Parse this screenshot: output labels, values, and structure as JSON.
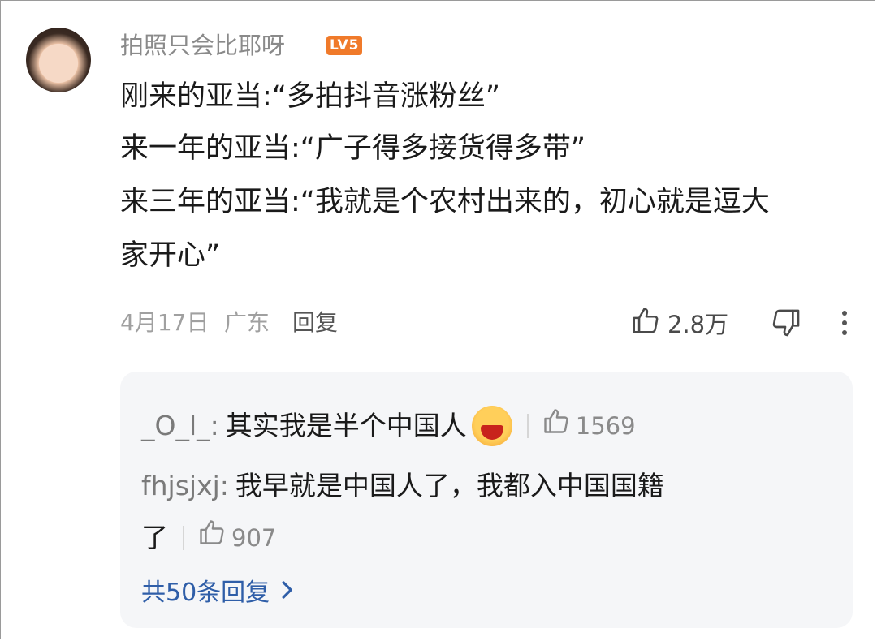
{
  "comment": {
    "username": "拍照只会比耶呀",
    "level_badge": "LV5",
    "lines": [
      "刚来的亚当:“多拍抖音涨粉丝”",
      "来一年的亚当:“广子得多接货得多带”",
      "来三年的亚当:“我就是个农村出来的，初心就是逗大",
      "家开心”"
    ],
    "date": "4月17日",
    "location": "广东",
    "reply_label": "回复",
    "like_count": "2.8万"
  },
  "replies": [
    {
      "user": "_O_l_:",
      "text": "其实我是半个中国人",
      "emoji": "laughing-emoji",
      "likes": "1569"
    },
    {
      "user": "fhjsjxj:",
      "text": "我早就是中国人了，我都入中国国籍",
      "text_cont": "了",
      "likes": "907"
    }
  ],
  "more_replies_label": "共50条回复",
  "colors": {
    "accent_link": "#2f5ea8",
    "badge": "#f07a2a"
  }
}
